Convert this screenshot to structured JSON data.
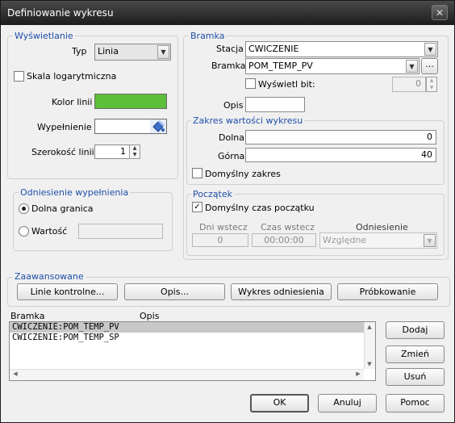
{
  "window": {
    "title": "Definiowanie wykresu",
    "close_glyph": "✕"
  },
  "display": {
    "group_title": "Wyświetlanie",
    "type_label": "Typ",
    "type_value": "Linia",
    "log_scale_label": "Skala logarytmiczna",
    "log_scale_checked": false,
    "line_color_label": "Kolor linii",
    "line_color": "#5cbf3a",
    "fill_label": "Wypełnienie",
    "fill_icon": "paint-bucket-icon",
    "line_width_label": "Szerokość linii",
    "line_width_value": "1"
  },
  "fill_ref": {
    "group_title": "Odniesienie wypełnienia",
    "lower_bound_label": "Dolna granica",
    "lower_bound_selected": true,
    "value_label": "Wartość",
    "value_selected": false,
    "value_input": ""
  },
  "gate": {
    "group_title": "Bramka",
    "station_label": "Stacja",
    "station_value": "CWICZENIE",
    "gate_label": "Bramka",
    "gate_value": "POM_TEMP_PV",
    "browse_label": "...",
    "show_bit_label": "Wyświetl bit:",
    "show_bit_checked": false,
    "bit_value": "0",
    "desc_label": "Opis",
    "desc_value": ""
  },
  "range": {
    "group_title": "Zakres wartości wykresu",
    "lower_label": "Dolna",
    "lower_value": "0",
    "upper_label": "Górna",
    "upper_value": "40",
    "default_range_label": "Domyślny zakres",
    "default_range_checked": false
  },
  "start": {
    "group_title": "Początek",
    "default_start_label": "Domyślny czas początku",
    "default_start_checked": true,
    "days_back_label": "Dni wstecz",
    "days_back_value": "0",
    "time_back_label": "Czas wstecz",
    "time_back_value": "00:00:00",
    "reference_label": "Odniesienie",
    "reference_value": "Względne"
  },
  "advanced": {
    "group_title": "Zaawansowane",
    "control_lines_label": "Linie kontrolne...",
    "description_label": "Opis...",
    "reference_chart_label": "Wykres odniesienia",
    "sampling_label": "Próbkowanie"
  },
  "list": {
    "col_gate": "Bramka",
    "col_desc": "Opis",
    "rows": [
      "CWICZENIE:POM_TEMP_PV",
      "CWICZENIE:POM_TEMP_SP"
    ],
    "selected_index": 0
  },
  "side_buttons": {
    "add_label": "Dodaj",
    "change_label": "Zmień",
    "remove_label": "Usuń"
  },
  "footer": {
    "ok_label": "OK",
    "cancel_label": "Anuluj",
    "help_label": "Pomoc"
  }
}
